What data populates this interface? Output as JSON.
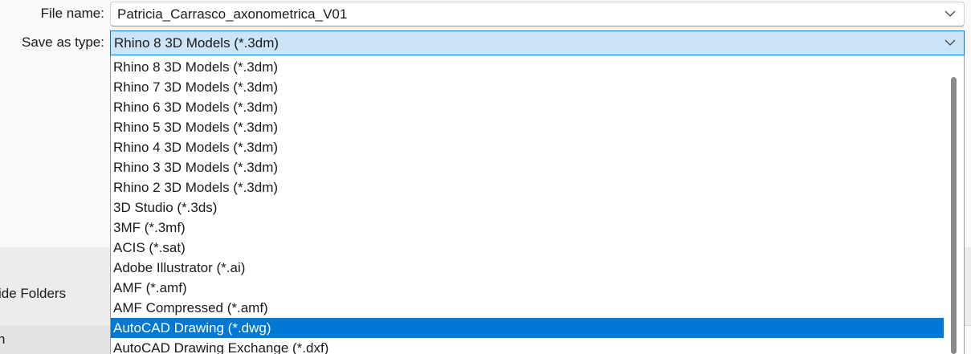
{
  "filename": {
    "label": "File name:",
    "value": "Patricia_Carrasco_axonometrica_V01"
  },
  "save_type": {
    "label": "Save as type:",
    "selected": "Rhino 8 3D Models (*.3dm)",
    "options": [
      "Rhino 8 3D Models (*.3dm)",
      "Rhino 7 3D Models (*.3dm)",
      "Rhino 6 3D Models (*.3dm)",
      "Rhino 5 3D Models (*.3dm)",
      "Rhino 4 3D Models (*.3dm)",
      "Rhino 3 3D Models (*.3dm)",
      "Rhino 2 3D Models (*.3dm)",
      "3D Studio (*.3ds)",
      "3MF (*.3mf)",
      "ACIS (*.sat)",
      "Adobe Illustrator (*.ai)",
      "AMF (*.amf)",
      "AMF Compressed (*.amf)",
      "AutoCAD Drawing (*.dwg)",
      "AutoCAD Drawing Exchange (*.dxf)"
    ],
    "highlighted_option": "AutoCAD Drawing (*.dwg)"
  },
  "footer": {
    "hide_folders_label": "ide Folders",
    "partial_item_label": "n"
  },
  "icons": {
    "filename_dropdown": "chevron-down-icon",
    "type_dropdown": "chevron-down-icon"
  },
  "colors": {
    "accent": "#0078d4",
    "selected_field": "#cce4f7",
    "list_background": "#ffffff",
    "dialog_background": "#f9f9f9"
  }
}
